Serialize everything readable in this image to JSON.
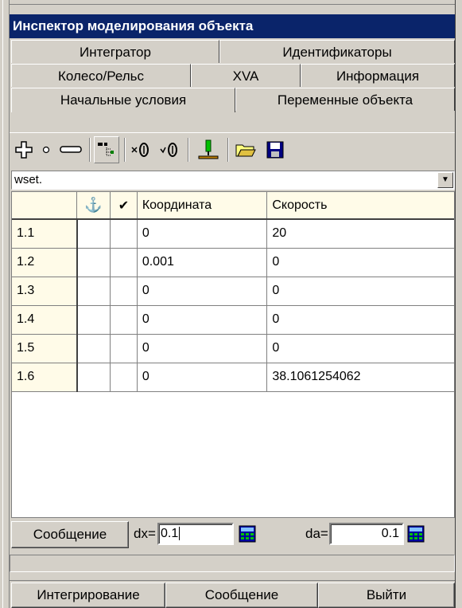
{
  "window": {
    "title": "Инспектор моделирования объекта"
  },
  "tabs": {
    "row1": [
      "Интегратор",
      "Идентификаторы"
    ],
    "row2": [
      "Колесо/Рельс",
      "XVA",
      "Информация"
    ],
    "row3": [
      "Начальные условия",
      "Переменные объекта"
    ],
    "active": "Начальные условия"
  },
  "toolbar": {
    "icons": [
      "add-icon",
      "dot-icon",
      "remove-icon",
      "tree-icon",
      "multiply-zero-icon",
      "check-zero-icon",
      "probe-icon",
      "open-folder-icon",
      "save-icon"
    ]
  },
  "combo": {
    "value": "wset."
  },
  "grid": {
    "headers": [
      "",
      "⚓",
      "✔",
      "Координата",
      "Скорость"
    ],
    "rows": [
      {
        "id": "1.1",
        "coord": "0",
        "speed": "20"
      },
      {
        "id": "1.2",
        "coord": "0.001",
        "speed": "0"
      },
      {
        "id": "1.3",
        "coord": "0",
        "speed": "0"
      },
      {
        "id": "1.4",
        "coord": "0",
        "speed": "0"
      },
      {
        "id": "1.5",
        "coord": "0",
        "speed": "0"
      },
      {
        "id": "1.6",
        "coord": "0",
        "speed": "38.1061254062"
      }
    ]
  },
  "controls": {
    "message_button": "Сообщение",
    "dx_label": "dx=",
    "dx_value": "0.1",
    "da_label": "da=",
    "da_value": "0.1"
  },
  "bottom": {
    "integrate": "Интегрирование",
    "message": "Сообщение",
    "exit": "Выйти"
  },
  "colors": {
    "title_bg": "#0a246a",
    "grid_header_bg": "#fffbe8",
    "face": "#d4d0c8"
  }
}
